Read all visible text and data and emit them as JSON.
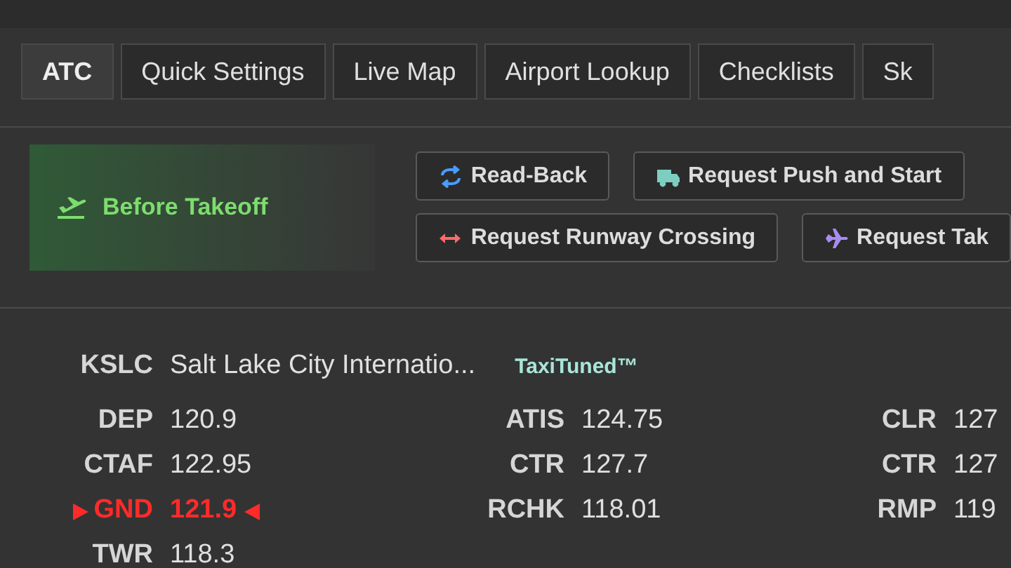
{
  "tabs": [
    {
      "label": "ATC",
      "selected": true
    },
    {
      "label": "Quick Settings",
      "selected": false
    },
    {
      "label": "Live Map",
      "selected": false
    },
    {
      "label": "Airport Lookup",
      "selected": false
    },
    {
      "label": "Checklists",
      "selected": false
    },
    {
      "label": "Sk",
      "selected": false
    }
  ],
  "phase": {
    "label": "Before Takeoff"
  },
  "actions": [
    [
      {
        "label": "Read-Back"
      },
      {
        "label": "Request Push and Start"
      }
    ],
    [
      {
        "label": "Request Runway Crossing"
      },
      {
        "label": "Request Tak"
      }
    ]
  ],
  "airport": {
    "code": "KSLC",
    "name": "Salt Lake City Internatio...",
    "tag": "TaxiTuned™"
  },
  "frequencies": [
    [
      {
        "label": "DEP",
        "value": "120.9",
        "selected": false
      },
      {
        "label": "CTAF",
        "value": "122.95",
        "selected": false
      },
      {
        "label": "GND",
        "value": "121.9",
        "selected": true
      },
      {
        "label": "TWR",
        "value": "118.3",
        "selected": false
      }
    ],
    [
      {
        "label": "ATIS",
        "value": "124.75",
        "selected": false
      },
      {
        "label": "CTR",
        "value": "127.7",
        "selected": false
      },
      {
        "label": "RCHK",
        "value": "118.01",
        "selected": false
      }
    ],
    [
      {
        "label": "CLR",
        "value": "127",
        "selected": false
      },
      {
        "label": "CTR",
        "value": "127",
        "selected": false
      },
      {
        "label": "RMP",
        "value": "119",
        "selected": false
      }
    ]
  ]
}
